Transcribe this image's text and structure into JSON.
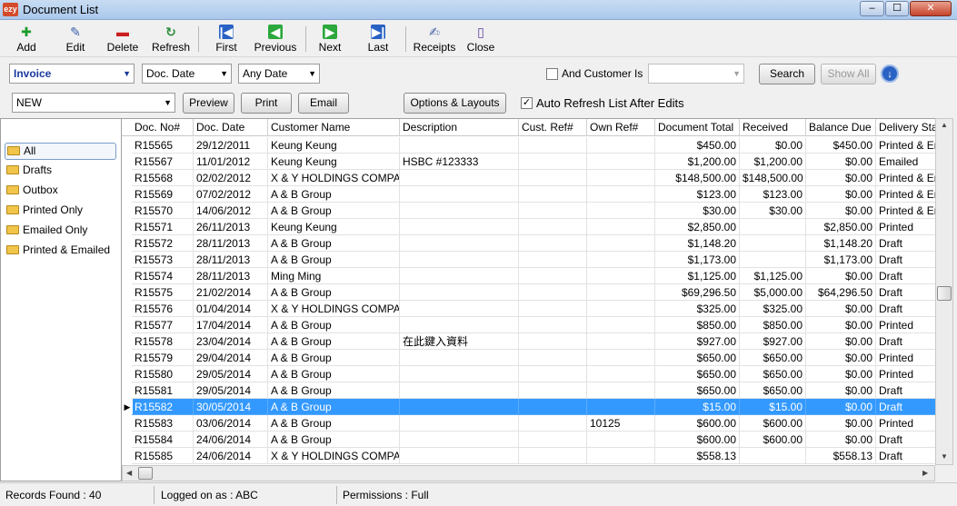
{
  "window": {
    "title": "Document List",
    "app_badge": "ezy",
    "controls": [
      "–",
      "☐",
      "✕"
    ]
  },
  "toolbar": {
    "add": "Add",
    "edit": "Edit",
    "delete": "Delete",
    "refresh": "Refresh",
    "first": "First",
    "previous": "Previous",
    "next": "Next",
    "last": "Last",
    "receipts": "Receipts",
    "close": "Close"
  },
  "filters": {
    "doc_type": "Invoice",
    "sort_by": "Doc. Date",
    "date_range": "Any Date",
    "and_customer_label": "And Customer Is",
    "customer_value": "",
    "search": "Search",
    "show_all": "Show All",
    "status": "NEW",
    "preview": "Preview",
    "print": "Print",
    "email": "Email",
    "options_layouts": "Options & Layouts",
    "auto_refresh_label": "Auto Refresh List After Edits",
    "auto_refresh_checked": true,
    "and_customer_checked": false
  },
  "sidebar": {
    "items": [
      "All",
      "Drafts",
      "Outbox",
      "Printed Only",
      "Emailed Only",
      "Printed & Emailed"
    ],
    "active": "All"
  },
  "table": {
    "columns": [
      "Doc. No#",
      "Doc. Date",
      "Customer Name",
      "Description",
      "Cust. Ref#",
      "Own Ref#",
      "Document Total",
      "Received",
      "Balance Due",
      "Delivery Status"
    ],
    "rows": [
      [
        "R15565",
        "29/12/2011",
        "Keung Keung",
        "",
        "",
        "",
        "$450.00",
        "$0.00",
        "$450.00",
        "Printed & Emailed"
      ],
      [
        "R15567",
        "11/01/2012",
        "Keung Keung",
        "HSBC #123333",
        "",
        "",
        "$1,200.00",
        "$1,200.00",
        "$0.00",
        "Emailed"
      ],
      [
        "R15568",
        "02/02/2012",
        "X & Y HOLDINGS COMPANY",
        "",
        "",
        "",
        "$148,500.00",
        "$148,500.00",
        "$0.00",
        "Printed & Emailed"
      ],
      [
        "R15569",
        "07/02/2012",
        "A & B Group",
        "",
        "",
        "",
        "$123.00",
        "$123.00",
        "$0.00",
        "Printed & Emailed"
      ],
      [
        "R15570",
        "14/06/2012",
        "A & B Group",
        "",
        "",
        "",
        "$30.00",
        "$30.00",
        "$0.00",
        "Printed & Emailed"
      ],
      [
        "R15571",
        "26/11/2013",
        "Keung Keung",
        "",
        "",
        "",
        "$2,850.00",
        "",
        "$2,850.00",
        "Printed"
      ],
      [
        "R15572",
        "28/11/2013",
        "A & B Group",
        "",
        "",
        "",
        "$1,148.20",
        "",
        "$1,148.20",
        "Draft"
      ],
      [
        "R15573",
        "28/11/2013",
        "A & B Group",
        "",
        "",
        "",
        "$1,173.00",
        "",
        "$1,173.00",
        "Draft"
      ],
      [
        "R15574",
        "28/11/2013",
        "Ming Ming",
        "",
        "",
        "",
        "$1,125.00",
        "$1,125.00",
        "$0.00",
        "Draft"
      ],
      [
        "R15575",
        "21/02/2014",
        "A & B Group",
        "",
        "",
        "",
        "$69,296.50",
        "$5,000.00",
        "$64,296.50",
        "Draft"
      ],
      [
        "R15576",
        "01/04/2014",
        "X & Y HOLDINGS COMPANY",
        "",
        "",
        "",
        "$325.00",
        "$325.00",
        "$0.00",
        "Draft"
      ],
      [
        "R15577",
        "17/04/2014",
        "A & B Group",
        "",
        "",
        "",
        "$850.00",
        "$850.00",
        "$0.00",
        "Printed"
      ],
      [
        "R15578",
        "23/04/2014",
        "A & B Group",
        "在此鍵入資料",
        "",
        "",
        "$927.00",
        "$927.00",
        "$0.00",
        "Draft"
      ],
      [
        "R15579",
        "29/04/2014",
        "A & B Group",
        "",
        "",
        "",
        "$650.00",
        "$650.00",
        "$0.00",
        "Printed"
      ],
      [
        "R15580",
        "29/05/2014",
        "A & B Group",
        "",
        "",
        "",
        "$650.00",
        "$650.00",
        "$0.00",
        "Printed"
      ],
      [
        "R15581",
        "29/05/2014",
        "A & B Group",
        "",
        "",
        "",
        "$650.00",
        "$650.00",
        "$0.00",
        "Draft"
      ],
      [
        "R15582",
        "30/05/2014",
        "A & B Group",
        "",
        "",
        "",
        "$15.00",
        "$15.00",
        "$0.00",
        "Draft"
      ],
      [
        "R15583",
        "03/06/2014",
        "A & B Group",
        "",
        "",
        "10125",
        "$600.00",
        "$600.00",
        "$0.00",
        "Printed"
      ],
      [
        "R15584",
        "24/06/2014",
        "A & B Group",
        "",
        "",
        "",
        "$600.00",
        "$600.00",
        "$0.00",
        "Draft"
      ],
      [
        "R15585",
        "24/06/2014",
        "X & Y HOLDINGS COMPANY",
        "",
        "",
        "",
        "$558.13",
        "",
        "$558.13",
        "Draft"
      ]
    ],
    "selected_doc": "R15582",
    "selection_color": "#3399ff"
  },
  "status": {
    "records_found": "Records Found : 40",
    "logged_on": "Logged on as : ABC",
    "permissions": "Permissions : Full"
  }
}
